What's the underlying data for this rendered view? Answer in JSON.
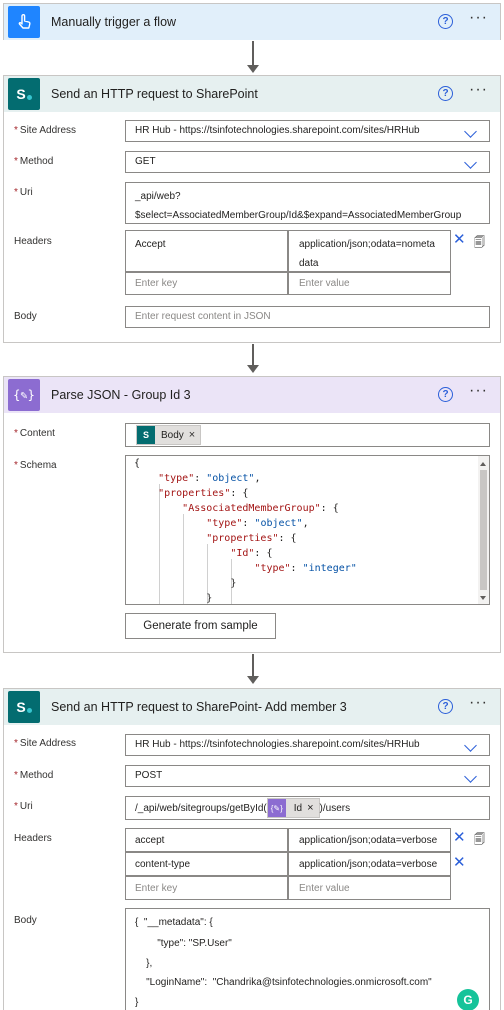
{
  "trigger": {
    "title": "Manually trigger a flow",
    "help": "?",
    "more": "···"
  },
  "step1": {
    "title": "Send an HTTP request to SharePoint",
    "help": "?",
    "more": "···",
    "site_label": "Site Address",
    "site_value": "HR Hub - https://tsinfotechnologies.sharepoint.com/sites/HRHub",
    "method_label": "Method",
    "method_value": "GET",
    "uri_label": "Uri",
    "uri_line1": "_api/web?",
    "uri_line2": "$select=AssociatedMemberGroup/Id&$expand=AssociatedMemberGroup",
    "headers_label": "Headers",
    "headers": [
      {
        "key": "Accept",
        "value_line1": "application/json;odata=nometa",
        "value_line2": "data"
      }
    ],
    "key_placeholder": "Enter key",
    "value_placeholder": "Enter value",
    "body_label": "Body",
    "body_placeholder": "Enter request content in JSON"
  },
  "step2": {
    "title": "Parse JSON - Group Id 3",
    "help": "?",
    "more": "···",
    "content_label": "Content",
    "content_token": "Body",
    "schema_label": "Schema",
    "schema_lines": [
      "{",
      "    \"type\": \"object\",",
      "    \"properties\": {",
      "        \"AssociatedMemberGroup\": {",
      "            \"type\": \"object\",",
      "            \"properties\": {",
      "                \"Id\": {",
      "                    \"type\": \"integer\"",
      "                }",
      "            }"
    ],
    "generate_button": "Generate from sample"
  },
  "step3": {
    "title": "Send an HTTP request to SharePoint- Add member 3",
    "help": "?",
    "more": "···",
    "site_label": "Site Address",
    "site_value": "HR Hub - https://tsinfotechnologies.sharepoint.com/sites/HRHub",
    "method_label": "Method",
    "method_value": "POST",
    "uri_label": "Uri",
    "uri_prefix": "/_api/web/sitegroups/getById(",
    "uri_token": "Id",
    "uri_suffix": ")/users",
    "headers_label": "Headers",
    "headers": [
      {
        "key": "accept",
        "value": "application/json;odata=verbose"
      },
      {
        "key": "content-type",
        "value": "application/json;odata=verbose"
      }
    ],
    "key_placeholder": "Enter key",
    "value_placeholder": "Enter value",
    "body_label": "Body",
    "body_lines": [
      "{  \"__metadata\": {",
      "        \"type\": \"SP.User\"",
      "    },",
      "    \"LoginName\":  \"Chandrika@tsinfotechnologies.onmicrosoft.com\"",
      "}"
    ]
  },
  "colors": {
    "trigger_header": "#e1effa",
    "sharepoint_header": "#e6f0f0",
    "parse_header": "#ebe4f7",
    "sharepoint_icon": "#036c70",
    "trigger_icon": "#1f85ff",
    "parse_icon": "#8c6cd1",
    "accent": "#2b5fd9",
    "grammarly": "#15c39a"
  }
}
